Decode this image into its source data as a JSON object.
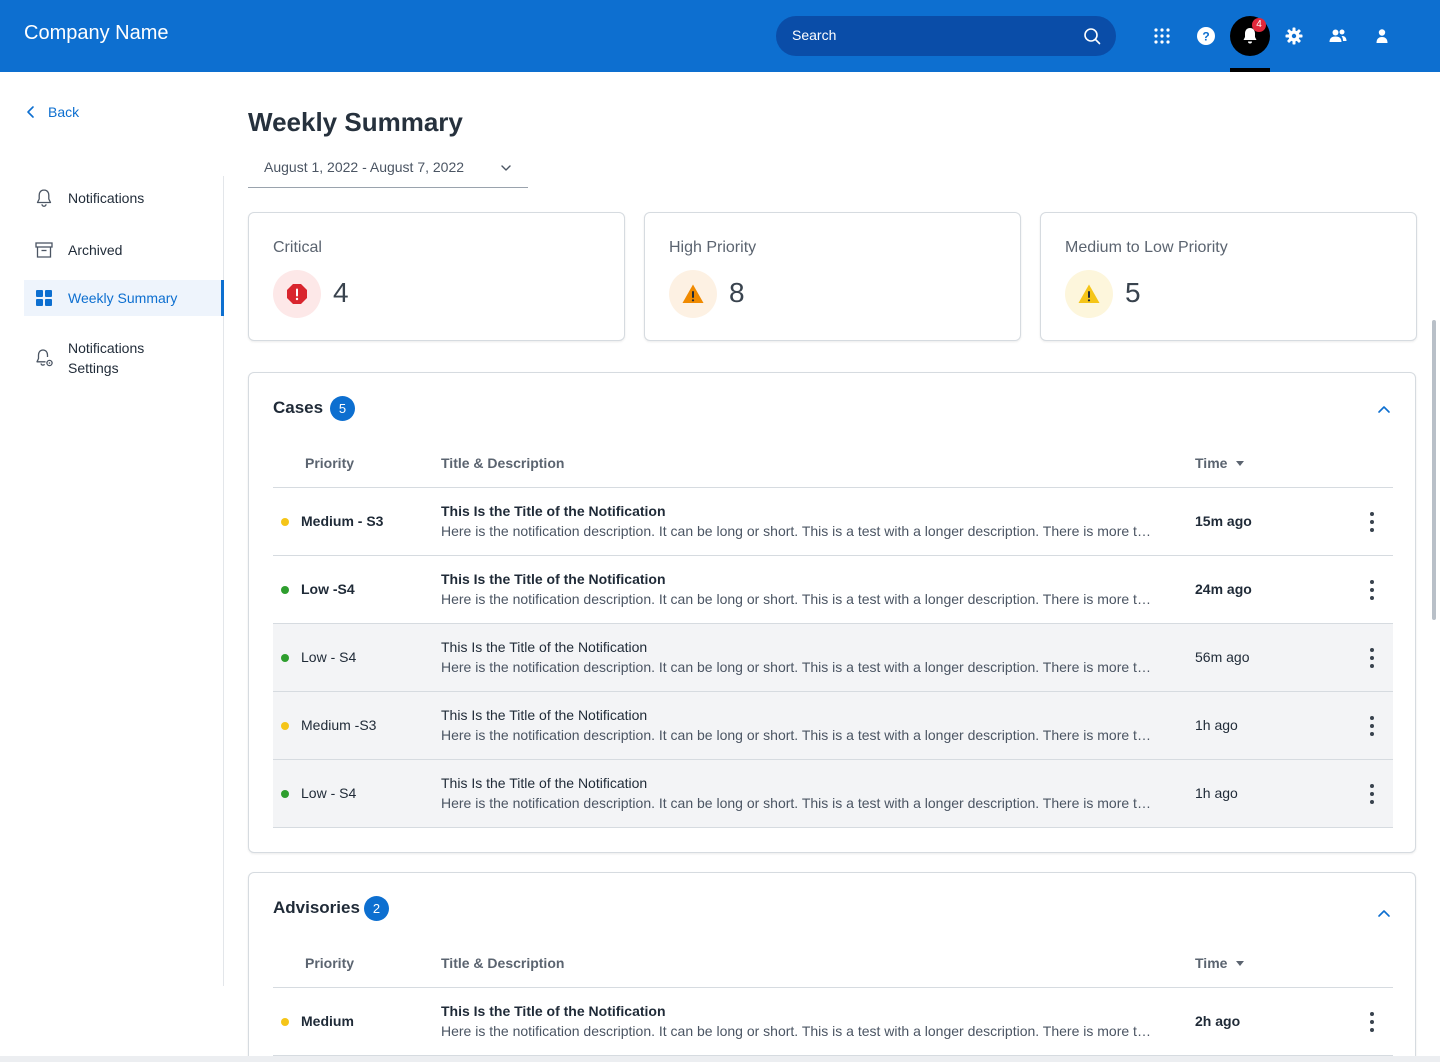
{
  "header": {
    "brand": "Company Name",
    "search_placeholder": "Search",
    "notification_count": "4",
    "icons": [
      "apps-grid-icon",
      "help-icon",
      "bell-icon",
      "gear-icon",
      "users-icon",
      "user-icon"
    ],
    "color": "#0d6fd0"
  },
  "sidebar": {
    "back_label": "Back",
    "items": [
      {
        "label": "Notifications",
        "icon": "bell-outline-icon",
        "active": false
      },
      {
        "label": "Archived",
        "icon": "archive-icon",
        "active": false
      },
      {
        "label": "Weekly Summary",
        "icon": "dashboard-grid-icon",
        "active": true
      },
      {
        "label": "Notifications Settings",
        "icon": "bell-gear-icon",
        "active": false
      }
    ]
  },
  "main": {
    "title": "Weekly Summary",
    "date_range": "August 1, 2022 - August 7, 2022",
    "stats": [
      {
        "label": "Critical",
        "value": "4",
        "icon": "critical-octagon-icon",
        "color": "#d9262e",
        "bg": "#fde8e8"
      },
      {
        "label": "High Priority",
        "value": "8",
        "icon": "warning-triangle-icon",
        "color": "#f08a00",
        "bg": "#fdf1e3"
      },
      {
        "label": "Medium to Low Priority",
        "value": "5",
        "icon": "warning-triangle-icon",
        "color": "#f5c518",
        "bg": "#fdf6dc"
      }
    ],
    "columns": {
      "priority": "Priority",
      "title": "Title & Description",
      "time": "Time"
    },
    "cases": {
      "title": "Cases",
      "count": "5",
      "rows": [
        {
          "priority": "Medium - S3",
          "title": "This Is the Title of the Notification",
          "description": "Here is the notification description. It can be long or short. This is a test with a longer description. There is more text that continues beyond the visible area.",
          "time": "15m ago",
          "unread": true,
          "dot": "#f5c518"
        },
        {
          "priority": "Low -S4",
          "title": "This Is the Title of the Notification",
          "description": "Here is the notification description. It can be long or short. This is a test with a longer description. There is more text that continues beyond the visible area.",
          "time": "24m ago",
          "unread": true,
          "dot": "#2e9e2e"
        },
        {
          "priority": "Low - S4",
          "title": "This Is the Title of the Notification",
          "description": "Here is the notification description. It can be long or short. This is a test with a longer description. There is more text that continues beyond the visible area.",
          "time": "56m ago",
          "unread": false,
          "dot": "#2e9e2e"
        },
        {
          "priority": "Medium -S3",
          "title": "This Is the Title of the Notification",
          "description": "Here is the notification description. It can be long or short. This is a test with a longer description. There is more text that continues beyond the visible area.",
          "time": "1h ago",
          "unread": false,
          "dot": "#f5c518"
        },
        {
          "priority": "Low - S4",
          "title": "This Is the Title of the Notification",
          "description": "Here is the notification description. It can be long or short. This is a test with a longer description. There is more text that continues beyond the visible area.",
          "time": "1h ago",
          "unread": false,
          "dot": "#2e9e2e"
        }
      ]
    },
    "advisories": {
      "title": "Advisories",
      "count": "2",
      "rows": [
        {
          "priority": "Medium",
          "title": "This Is the Title of the Notification",
          "description": "Here is the notification description. It can be long or short. This is a test with a longer description. There is more text that continues beyond the visible area.",
          "time": "2h ago",
          "unread": true,
          "dot": "#f5c518"
        }
      ]
    }
  }
}
